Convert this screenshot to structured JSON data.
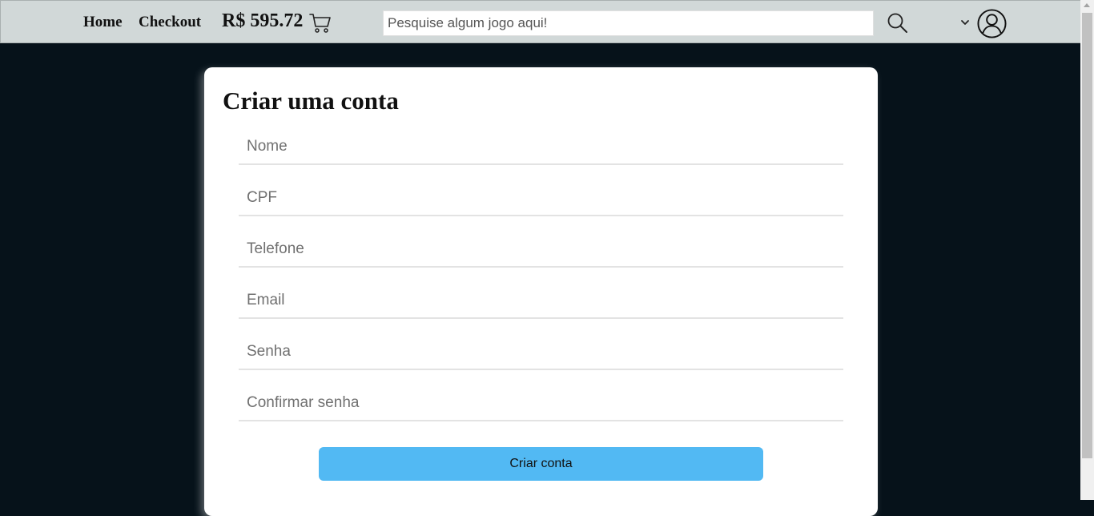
{
  "navbar": {
    "home_label": "Home",
    "checkout_label": "Checkout",
    "cart_total": "R$ 595.72",
    "search_placeholder": "Pesquise algum jogo aqui!"
  },
  "form": {
    "title": "Criar uma conta",
    "fields": [
      {
        "placeholder": "Nome"
      },
      {
        "placeholder": "CPF"
      },
      {
        "placeholder": "Telefone"
      },
      {
        "placeholder": "Email"
      },
      {
        "placeholder": "Senha"
      },
      {
        "placeholder": "Confirmar senha"
      }
    ],
    "submit_label": "Criar conta"
  },
  "icons": {
    "cart": "cart-icon",
    "search": "search-icon",
    "menu": "chevron-down-icon",
    "user": "user-icon"
  },
  "colors": {
    "navbar_bg": "#d1d8d8",
    "page_bg": "#06121a",
    "button_bg": "#52b9f3",
    "card_bg": "#ffffff"
  }
}
